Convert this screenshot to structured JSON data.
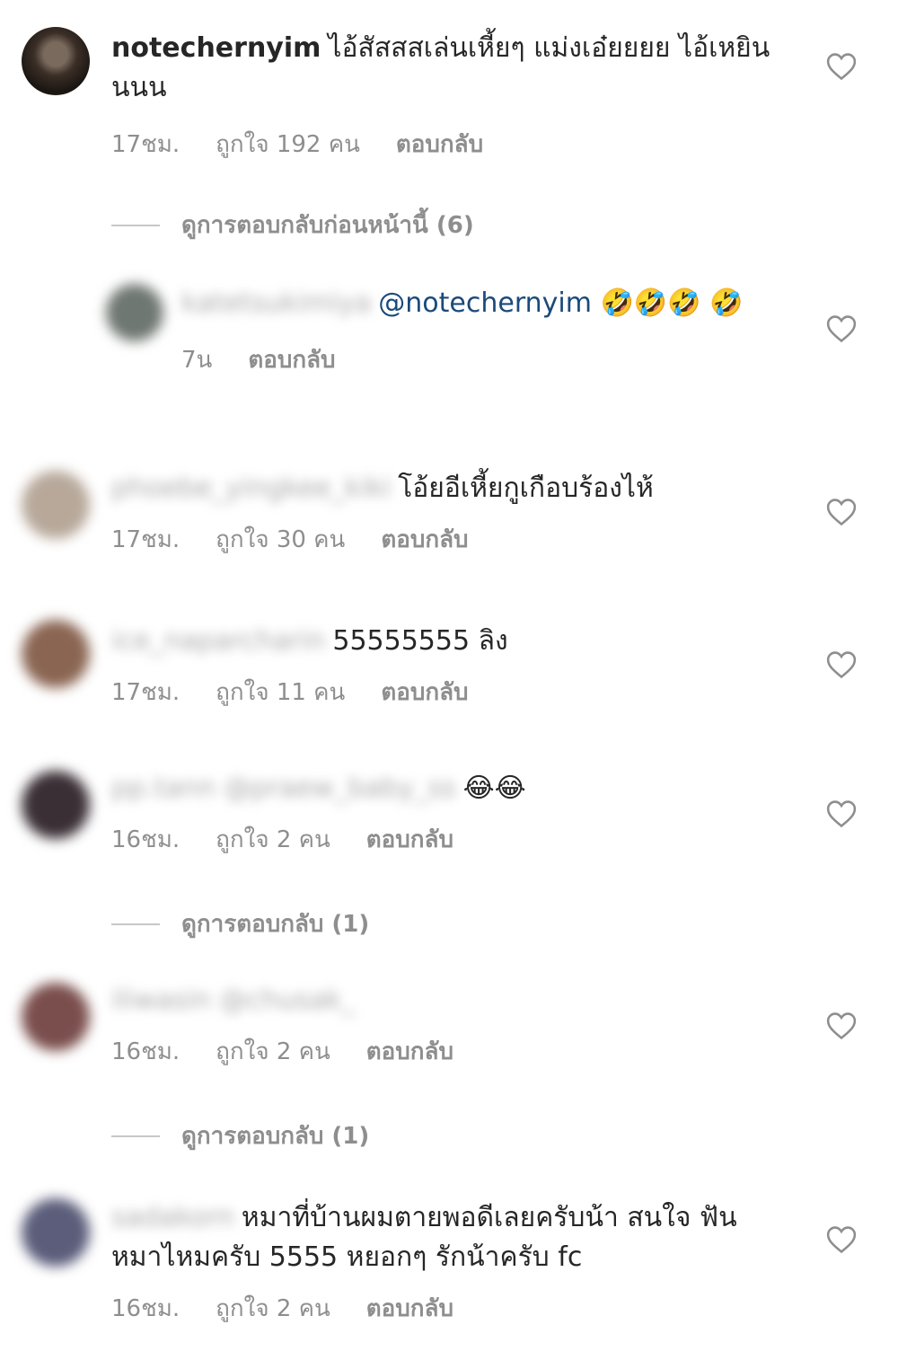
{
  "comments": [
    {
      "username": "notechernyim",
      "text": "ไอ้สัสสสเล่นเหี้ยๆ แม่งเอ๋ยยยย ไอ้เหยินนนน",
      "time": "17ชม.",
      "likes": "ถูกใจ 192 คน",
      "reply": "ตอบกลับ",
      "view_replies": "ดูการตอบกลับก่อนหน้านี้ (6)"
    },
    {
      "username": "katetsukimiya",
      "mention": "@notechernyim",
      "emoji": "🤣🤣🤣 🤣",
      "time": "7น",
      "reply": "ตอบกลับ"
    },
    {
      "username": "phoebe_yingkee_kiki",
      "text": "โอ้ยอีเหี้ยกูเกือบร้องไห้",
      "time": "17ชม.",
      "likes": "ถูกใจ 30 คน",
      "reply": "ตอบกลับ"
    },
    {
      "username": "ice_naparcharin",
      "text": "55555555 ลิง",
      "time": "17ชม.",
      "likes": "ถูกใจ 11 คน",
      "reply": "ตอบกลับ"
    },
    {
      "username": "pp.tann @praew_baby_ss",
      "emoji": "😂😂",
      "time": "16ชม.",
      "likes": "ถูกใจ 2 คน",
      "reply": "ตอบกลับ",
      "view_replies": "ดูการตอบกลับ (1)"
    },
    {
      "username": "iliwasin @chusak_",
      "time": "16ชม.",
      "likes": "ถูกใจ 2 คน",
      "reply": "ตอบกลับ",
      "view_replies": "ดูการตอบกลับ (1)"
    },
    {
      "username": "sadakorn",
      "text": "หมาที่บ้านผมตายพอดีเลยครับน้า สนใจ ฟันหมาไหมครับ 5555 หยอกๆ รักน้าครับ fc",
      "time": "16ชม.",
      "likes": "ถูกใจ 2 คน",
      "reply": "ตอบกลับ"
    }
  ],
  "colors": {
    "meta": "#8e8e8e",
    "text": "#262626",
    "mention": "#1a4a7a"
  },
  "icons": {
    "like": "heart-outline-icon"
  }
}
